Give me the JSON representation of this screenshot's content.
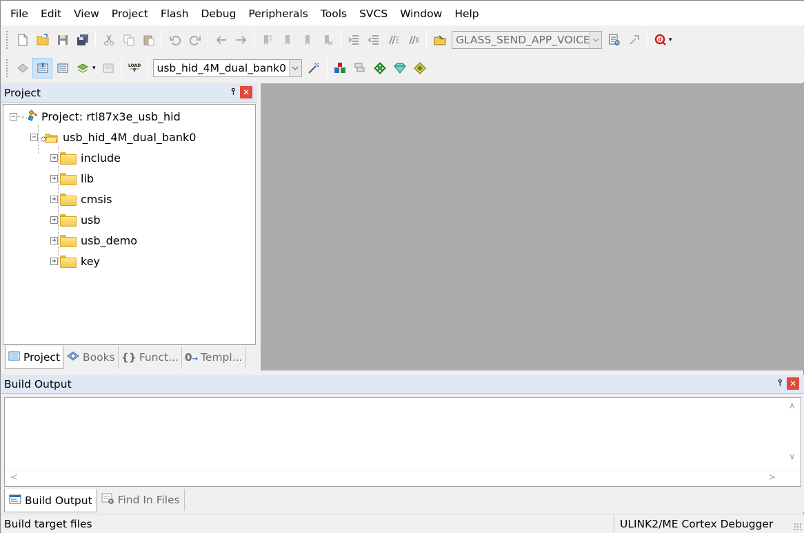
{
  "menu": [
    "File",
    "Edit",
    "View",
    "Project",
    "Flash",
    "Debug",
    "Peripherals",
    "Tools",
    "SVCS",
    "Window",
    "Help"
  ],
  "toolbar1": {
    "target_combo": "GLASS_SEND_APP_VOICE"
  },
  "toolbar2": {
    "load_label": "LOAD",
    "target_combo": "usb_hid_4M_dual_bank0"
  },
  "project_pane": {
    "title": "Project",
    "pin": "ᵖ",
    "close": "x",
    "tree": {
      "root": "Project: rtl87x3e_usb_hid",
      "target": "usb_hid_4M_dual_bank0",
      "groups": [
        "include",
        "lib",
        "cmsis",
        "usb",
        "usb_demo",
        "key"
      ]
    },
    "tabs": [
      {
        "icon": "project-icon",
        "label": "Project"
      },
      {
        "icon": "books-icon",
        "label": "Books"
      },
      {
        "icon": "functions-icon",
        "label": "Funct..."
      },
      {
        "icon": "templates-icon",
        "label": "Templ..."
      }
    ]
  },
  "build_pane": {
    "title": "Build Output",
    "tabs": [
      {
        "icon": "build-output-icon",
        "label": "Build Output"
      },
      {
        "icon": "find-in-files-icon",
        "label": "Find In Files"
      }
    ]
  },
  "status": {
    "left": "Build target files",
    "right": "ULINK2/ME Cortex Debugger"
  },
  "colors": {
    "pane_title_bg": "#dfe8f4",
    "close_red": "#e04a3e",
    "editor_bg": "#ababab"
  }
}
